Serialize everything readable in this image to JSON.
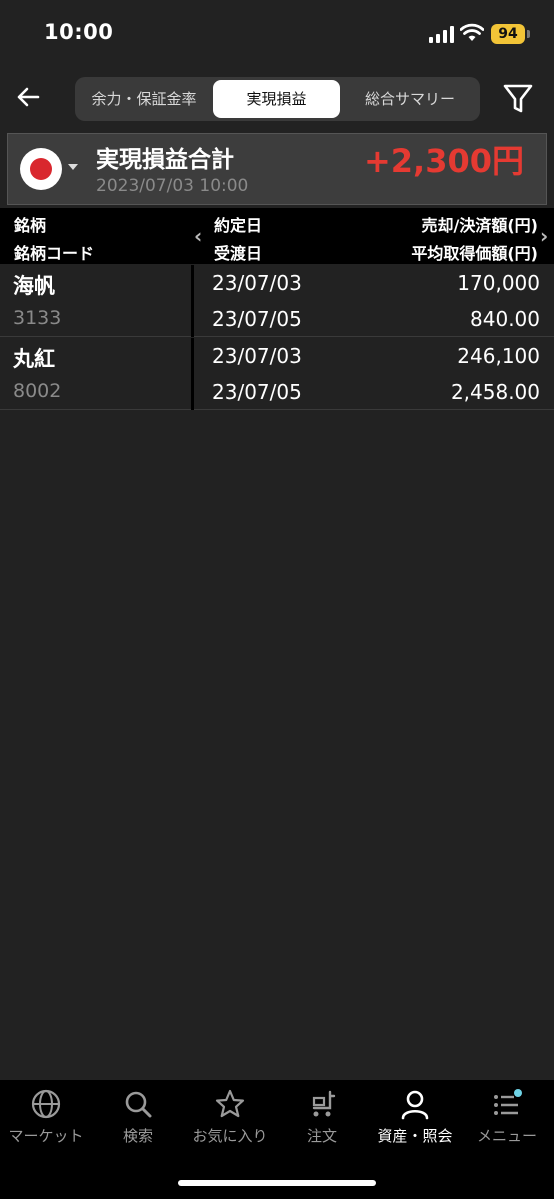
{
  "status": {
    "time": "10:00",
    "battery": "94"
  },
  "header": {
    "tabs": [
      {
        "label": "余力・保証金率"
      },
      {
        "label": "実現損益"
      },
      {
        "label": "総合サマリー"
      }
    ]
  },
  "summary": {
    "title": "実現損益合計",
    "total": "+2,300円",
    "date": "2023/07/03 10:00"
  },
  "table": {
    "headers": {
      "col1_line1": "銘柄",
      "col1_line2": "銘柄コード",
      "col2_line1": "約定日",
      "col2_line2": "受渡日",
      "col3_line1": "売却/決済額(円)",
      "col3_line2": "平均取得価額(円)"
    },
    "rows": [
      {
        "name": "海帆",
        "code": "3133",
        "trade_date": "23/07/03",
        "settle_date": "23/07/05",
        "amount": "170,000",
        "avg_price": "840.00"
      },
      {
        "name": "丸紅",
        "code": "8002",
        "trade_date": "23/07/03",
        "settle_date": "23/07/05",
        "amount": "246,100",
        "avg_price": "2,458.00"
      }
    ]
  },
  "tabbar": {
    "items": [
      {
        "label": "マーケット",
        "icon": "globe-icon"
      },
      {
        "label": "検索",
        "icon": "search-icon"
      },
      {
        "label": "お気に入り",
        "icon": "star-icon"
      },
      {
        "label": "注文",
        "icon": "cart-icon"
      },
      {
        "label": "資産・照会",
        "icon": "person-icon"
      },
      {
        "label": "メニュー",
        "icon": "list-icon"
      }
    ],
    "active_index": 4
  },
  "colors": {
    "profit": "#e53a32",
    "background": "#222222",
    "accent_dot": "#6fd3e6"
  }
}
